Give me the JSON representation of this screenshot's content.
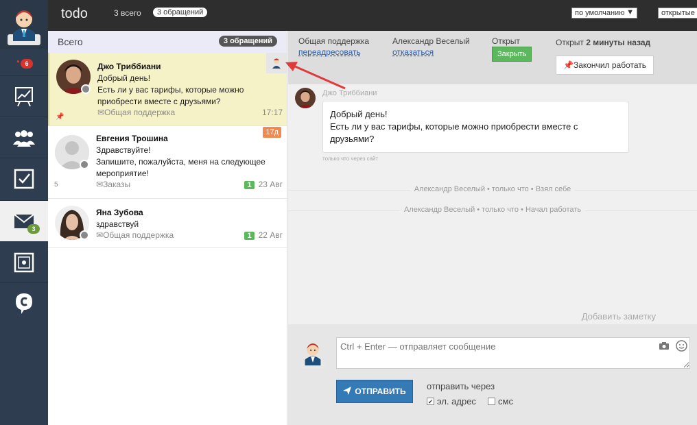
{
  "topbar": {
    "title": "todo",
    "total": "3 всего",
    "pill": "3 обращений",
    "sort_select": "по умолчанию",
    "status_select": "открытые"
  },
  "sidebar": {
    "notifications_badge": "6",
    "mail_badge": "3"
  },
  "list": {
    "header_label": "Всего",
    "header_count": "3 обращений",
    "items": [
      {
        "name": "Джо Триббиани",
        "text": "Добрый день!\nЕсть ли у вас тарифы, которые можно приобрести вместе с друзьями?",
        "category": "Общая поддержка",
        "time": "17:17"
      },
      {
        "name": "Евгения Трошина",
        "text": "Здравствуйте!\nЗапишите, пожалуйста, меня на следующее мероприятие!",
        "category": "Заказы",
        "badge": "1",
        "date": "23 Авг",
        "side_count": "5",
        "age": "17д"
      },
      {
        "name": "Яна Зубова",
        "text": "здравствуй",
        "category": "Общая поддержка",
        "badge": "1",
        "date": "22 Авг"
      }
    ]
  },
  "header": {
    "group_label": "Общая поддержка",
    "group_link": "переадресовать",
    "agent_label": "Александр Веселый",
    "agent_link": "отказаться",
    "status_label": "Открыт",
    "close_button": "Закрыть",
    "opened_prefix": "Открыт",
    "opened_value": "2 минуты назад",
    "finish_button": "Закончил работать"
  },
  "messages": {
    "author": "Джо Триббиани",
    "body": "Добрый день!\nЕсть ли у вас тарифы, которые можно приобрести вместе с друзьями?",
    "via": "только что через сайт",
    "system": [
      "Александр Веселый • только что • Взял себе",
      "Александр Веселый • только что • Начал работать"
    ],
    "add_note": "Добавить заметку"
  },
  "composer": {
    "placeholder": "Ctrl + Enter — отправляет сообщение",
    "send_button": "ОТПРАВИТЬ",
    "send_via": "отправить через",
    "email_label": "эл. адрес",
    "sms_label": "смс"
  },
  "colors": {
    "sidebar": "#2e3d4f",
    "topbar": "#2e2e2e",
    "selected_row": "#f5f2c8",
    "green": "#5cb85c",
    "blue": "#337ab7",
    "badge_red": "#d9332e",
    "age_orange": "#ef8a50",
    "arrow": "#e03a3a"
  }
}
